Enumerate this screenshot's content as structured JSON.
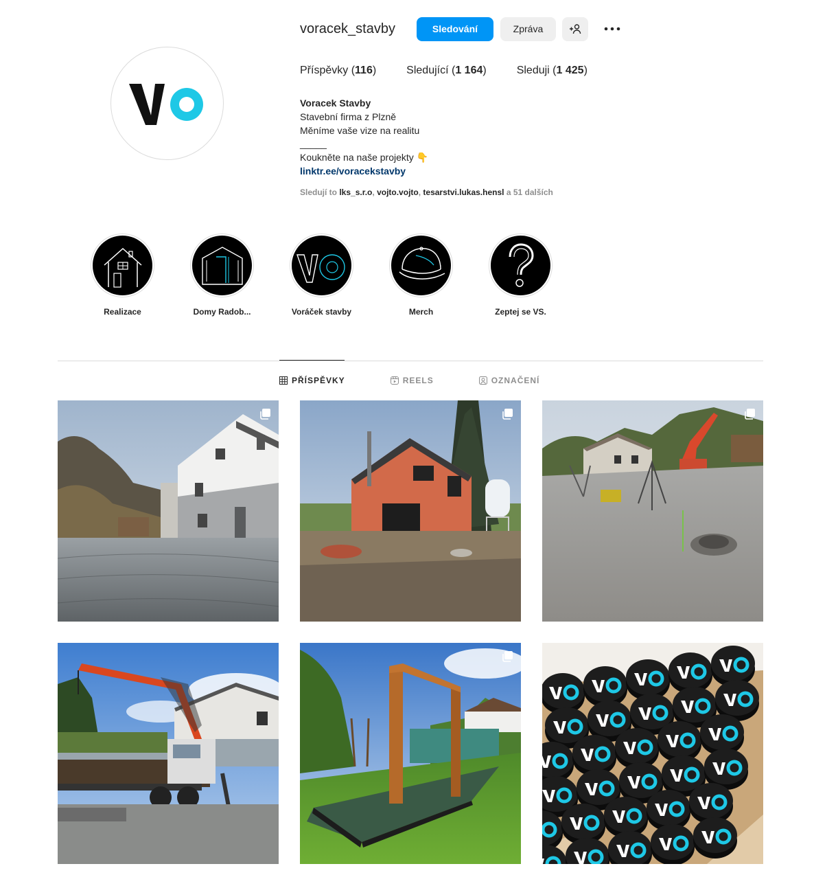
{
  "profile": {
    "username": "voracek_stavby",
    "follow_label": "Sledování",
    "message_label": "Zpráva",
    "stats": {
      "posts_label": "Příspěvky",
      "posts_count": "116",
      "followers_label": "Sledující",
      "followers_count": "1 164",
      "following_label": "Sleduji",
      "following_count": "1 425"
    },
    "bio": {
      "name": "Voracek Stavby",
      "line1": "Stavební firma z Plzně",
      "line2": "Měníme vaše vize na realitu",
      "line3": "_____",
      "line4": "Koukněte na naše projekty 👇",
      "link": "linktr.ee/voracekstavby"
    },
    "followed_by": {
      "prefix": "Sledují to",
      "user1": "lks_s.r.o",
      "user2": "vojto.vojto",
      "user3": "tesarstvi.lukas.hensl",
      "suffix": "a 51 dalších"
    }
  },
  "highlights": [
    {
      "label": "Realizace",
      "icon": "house-icon"
    },
    {
      "label": "Domy Radob...",
      "icon": "building-icon"
    },
    {
      "label": "Voráček stavby",
      "icon": "vo-logo-icon"
    },
    {
      "label": "Merch",
      "icon": "cap-icon"
    },
    {
      "label": "Zeptej se VS.",
      "icon": "question-icon"
    }
  ],
  "tabs": [
    {
      "label": "PŘÍSPĚVKY",
      "icon": "grid-icon",
      "active": true
    },
    {
      "label": "REELS",
      "icon": "reels-icon",
      "active": false
    },
    {
      "label": "OZNAČENÍ",
      "icon": "tagged-icon",
      "active": false
    }
  ],
  "posts": [
    {
      "subject": "house-with-cobblestone-driveway",
      "multiple": true
    },
    {
      "subject": "brick-house-under-construction",
      "multiple": true
    },
    {
      "subject": "construction-site-excavator",
      "multiple": true
    },
    {
      "subject": "crane-truck",
      "multiple": false
    },
    {
      "subject": "garden-pergola-terrace",
      "multiple": true
    },
    {
      "subject": "vo-branded-pucks-box",
      "multiple": false
    }
  ],
  "colors": {
    "accent": "#0095f6",
    "brand_cyan": "#1ec8e6",
    "link": "#00376b",
    "muted": "#8e8e8e"
  }
}
